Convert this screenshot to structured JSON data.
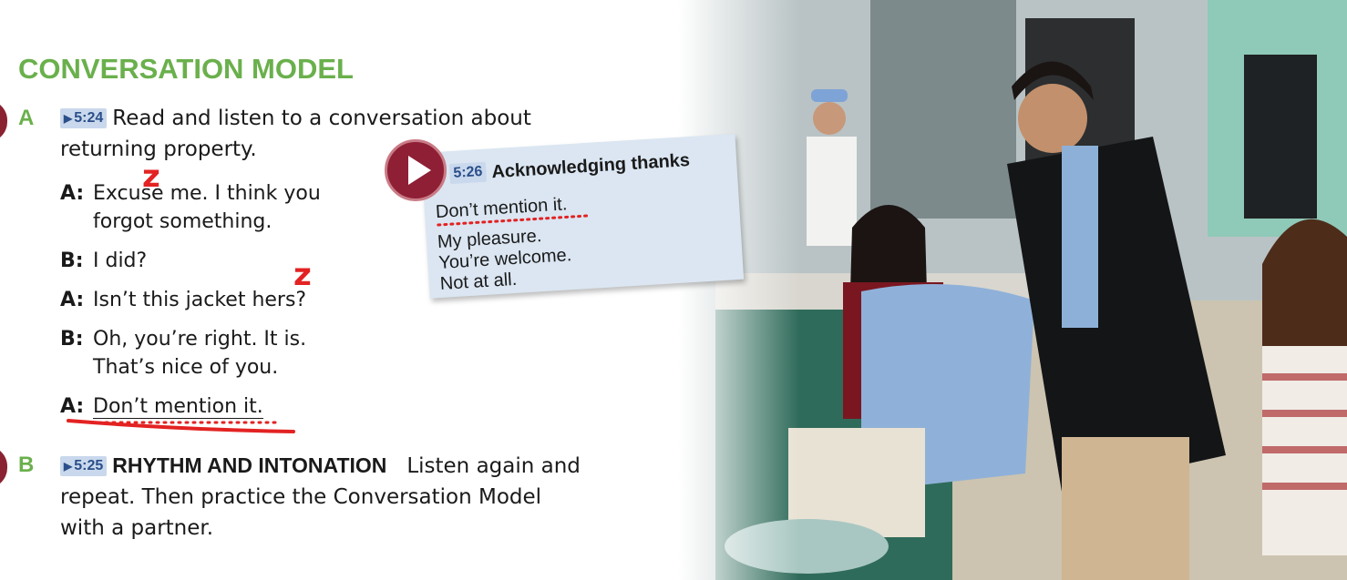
{
  "section_title": "CONVERSATION MODEL",
  "part_a": {
    "letter": "A",
    "audio_track": "5:24",
    "instruction_line1": "Read and listen to a conversation about",
    "instruction_line2": "returning property.",
    "dialogue": [
      {
        "speaker": "A:",
        "line1": "Excuse me. I think you",
        "line2": "forgot something."
      },
      {
        "speaker": "B:",
        "line1": "I did?"
      },
      {
        "speaker": "A:",
        "line1": "Isn’t this jacket hers?"
      },
      {
        "speaker": "B:",
        "line1": "Oh, you’re right. It is.",
        "line2": "That’s nice of you."
      },
      {
        "speaker": "A:",
        "line1": "Don’t mention it."
      }
    ]
  },
  "part_b": {
    "letter": "B",
    "audio_track": "5:25",
    "heading": "RHYTHM AND INTONATION",
    "instruction_line1": "Listen again and",
    "instruction_line2": "repeat. Then practice the Conversation Model",
    "instruction_line3": "with a partner."
  },
  "card": {
    "audio_track": "5:26",
    "title": "Acknowledging thanks",
    "items": [
      "Don’t mention it.",
      "My pleasure.",
      "You’re welcome.",
      "Not at all."
    ]
  },
  "handwritten_marks": [
    "z",
    "z"
  ],
  "colors": {
    "accent_green": "#6ab04c",
    "maroon": "#8e1f35",
    "card_blue": "#dbe6f2",
    "red_ink": "#e32222"
  },
  "photo_icon": "diner-counter-photo"
}
